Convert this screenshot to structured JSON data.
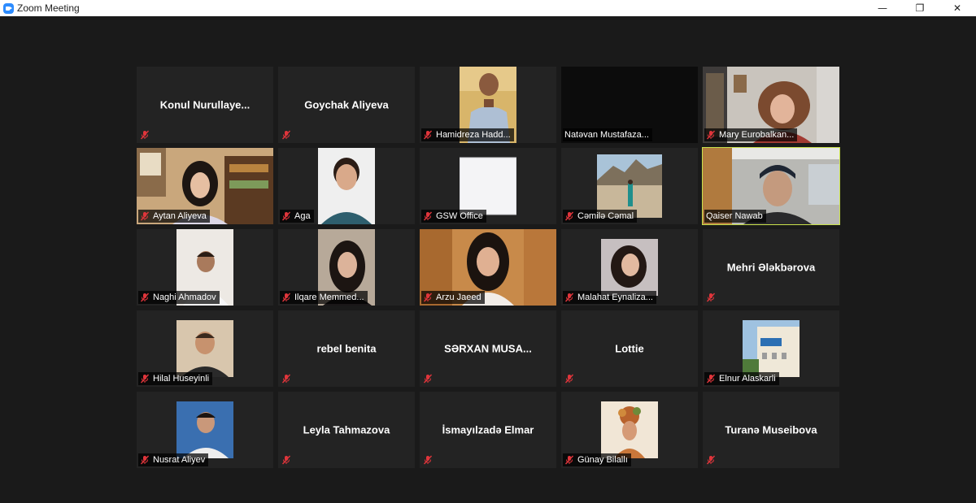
{
  "window": {
    "title": "Zoom Meeting",
    "controls": {
      "minimize": "—",
      "restore": "❐",
      "close": "✕"
    }
  },
  "colors": {
    "background": "#1a1a1a",
    "tile": "#232323",
    "active_speaker_border": "#c9e14c",
    "muted_icon": "#e0353b"
  },
  "participants": [
    {
      "name": "Konul  Nurullaye...",
      "video": false,
      "muted": true
    },
    {
      "name": "Goychak Aliyeva",
      "video": false,
      "muted": true
    },
    {
      "name": "Hamidreza Hadd...",
      "video": true,
      "muted": true
    },
    {
      "name": "Natəvan Mustafaza...",
      "video": true,
      "muted": false
    },
    {
      "name": "Mary Eurobalkan...",
      "video": true,
      "muted": true
    },
    {
      "name": "Aytan Aliyeva",
      "video": true,
      "muted": true
    },
    {
      "name": "Aga",
      "video": true,
      "muted": true
    },
    {
      "name": "GSW Office",
      "video": true,
      "muted": true
    },
    {
      "name": "Cəmilə Cəmal",
      "video": true,
      "muted": true
    },
    {
      "name": "Qaiser Nawab",
      "video": true,
      "muted": false,
      "active_speaker": true
    },
    {
      "name": "Naghi Ahmadov",
      "video": true,
      "muted": true
    },
    {
      "name": "Ilqare Memmed...",
      "video": true,
      "muted": true
    },
    {
      "name": "Arzu Jaeed",
      "video": true,
      "muted": true
    },
    {
      "name": "Malahat Eynaliza...",
      "video": true,
      "muted": true
    },
    {
      "name": "Mehri Ələkbərova",
      "video": false,
      "muted": true
    },
    {
      "name": "Hilal Huseyinli",
      "video": true,
      "muted": true
    },
    {
      "name": "rebel benita",
      "video": false,
      "muted": true
    },
    {
      "name": "SƏRXAN  MUSA...",
      "video": false,
      "muted": true
    },
    {
      "name": "Lottie",
      "video": false,
      "muted": true
    },
    {
      "name": "Elnur Alaskarli",
      "video": true,
      "muted": true
    },
    {
      "name": "Nusrat Aliyev",
      "video": true,
      "muted": true
    },
    {
      "name": "Leyla Tahmazova",
      "video": false,
      "muted": true
    },
    {
      "name": "İsmayılzadə Elmar",
      "video": false,
      "muted": true
    },
    {
      "name": "Günay Bilallı",
      "video": true,
      "muted": true
    },
    {
      "name": "Turanə Museibova",
      "video": false,
      "muted": true
    }
  ]
}
